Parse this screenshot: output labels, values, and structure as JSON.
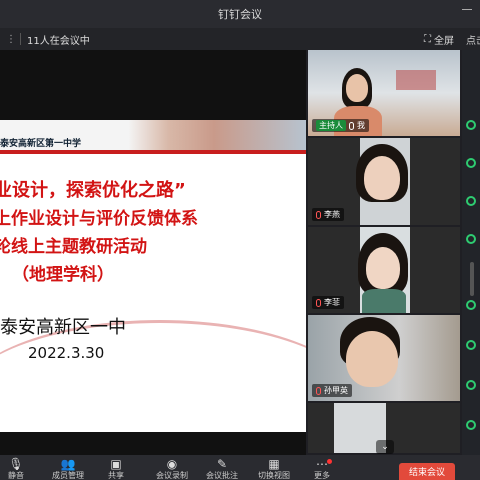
{
  "window": {
    "title": "钉钉会议"
  },
  "infobar": {
    "participants": "11人在会议中",
    "fullscreen": "全屏",
    "cut_text": "点击"
  },
  "slide": {
    "school": "泰安高新区第一中学",
    "line1": "业设计，探索优化之路”",
    "line2": "上作业设计与评价反馈体系",
    "line3": "轮线上主题教研活动",
    "line4": "（地理学科）",
    "org": "泰安高新区一中",
    "date": "2022.3.30"
  },
  "videos": [
    {
      "host_label": "主持人",
      "name": "我"
    },
    {
      "name": "李燕"
    },
    {
      "name": "李菲"
    },
    {
      "name": "孙甲英"
    }
  ],
  "toolbar": {
    "items": [
      {
        "icon": "mic-icon",
        "label": "静音"
      },
      {
        "icon": "people-icon",
        "label": "成员管理"
      },
      {
        "icon": "share-icon",
        "label": "共享"
      },
      {
        "icon": "record-icon",
        "label": "会议录制"
      },
      {
        "icon": "pen-icon",
        "label": "会议批注"
      },
      {
        "icon": "grid-icon",
        "label": "切换视图"
      },
      {
        "icon": "more-icon",
        "label": "更多"
      }
    ],
    "end_label": "结束会议"
  }
}
